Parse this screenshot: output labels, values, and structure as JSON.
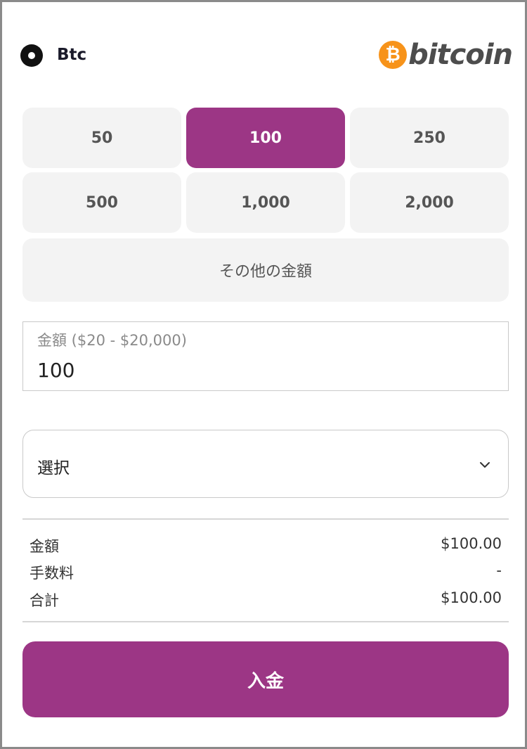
{
  "payment_method": {
    "name": "Btc",
    "logo_text": "bitcoin",
    "logo_symbol": "₿"
  },
  "presets": [
    {
      "label": "50",
      "selected": false
    },
    {
      "label": "100",
      "selected": true
    },
    {
      "label": "250",
      "selected": false
    },
    {
      "label": "500",
      "selected": false
    },
    {
      "label": "1,000",
      "selected": false
    },
    {
      "label": "2,000",
      "selected": false
    }
  ],
  "other_amount_label": "その他の金額",
  "amount_field": {
    "label": "金額 ($20 - $20,000)",
    "value": "100"
  },
  "select": {
    "value": "選択",
    "icon": "chevron-down-icon"
  },
  "summary": {
    "amount": {
      "label": "金額",
      "value": "$100.00"
    },
    "fee": {
      "label": "手数料",
      "value": "-"
    },
    "total": {
      "label": "合計",
      "value": "$100.00"
    }
  },
  "deposit_button": {
    "label": "入金"
  },
  "colors": {
    "accent": "#9c3685",
    "bitcoin_orange": "#f7931a",
    "preset_bg": "#f3f3f3"
  }
}
